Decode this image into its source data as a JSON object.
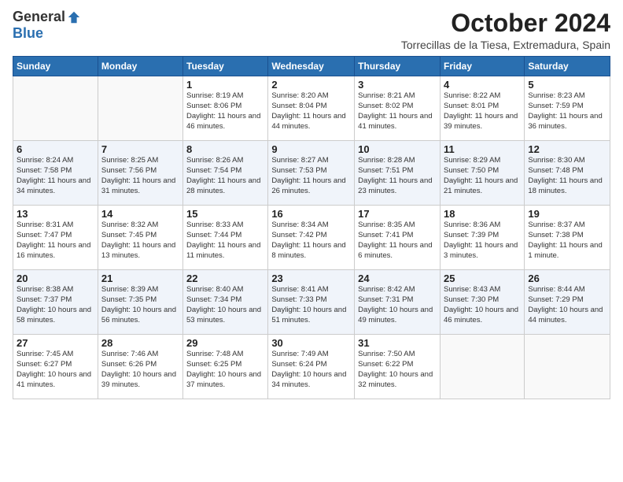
{
  "logo": {
    "general": "General",
    "blue": "Blue"
  },
  "header": {
    "month": "October 2024",
    "subtitle": "Torrecillas de la Tiesa, Extremadura, Spain"
  },
  "weekdays": [
    "Sunday",
    "Monday",
    "Tuesday",
    "Wednesday",
    "Thursday",
    "Friday",
    "Saturday"
  ],
  "weeks": [
    [
      {
        "day": "",
        "info": ""
      },
      {
        "day": "",
        "info": ""
      },
      {
        "day": "1",
        "info": "Sunrise: 8:19 AM\nSunset: 8:06 PM\nDaylight: 11 hours and 46 minutes."
      },
      {
        "day": "2",
        "info": "Sunrise: 8:20 AM\nSunset: 8:04 PM\nDaylight: 11 hours and 44 minutes."
      },
      {
        "day": "3",
        "info": "Sunrise: 8:21 AM\nSunset: 8:02 PM\nDaylight: 11 hours and 41 minutes."
      },
      {
        "day": "4",
        "info": "Sunrise: 8:22 AM\nSunset: 8:01 PM\nDaylight: 11 hours and 39 minutes."
      },
      {
        "day": "5",
        "info": "Sunrise: 8:23 AM\nSunset: 7:59 PM\nDaylight: 11 hours and 36 minutes."
      }
    ],
    [
      {
        "day": "6",
        "info": "Sunrise: 8:24 AM\nSunset: 7:58 PM\nDaylight: 11 hours and 34 minutes."
      },
      {
        "day": "7",
        "info": "Sunrise: 8:25 AM\nSunset: 7:56 PM\nDaylight: 11 hours and 31 minutes."
      },
      {
        "day": "8",
        "info": "Sunrise: 8:26 AM\nSunset: 7:54 PM\nDaylight: 11 hours and 28 minutes."
      },
      {
        "day": "9",
        "info": "Sunrise: 8:27 AM\nSunset: 7:53 PM\nDaylight: 11 hours and 26 minutes."
      },
      {
        "day": "10",
        "info": "Sunrise: 8:28 AM\nSunset: 7:51 PM\nDaylight: 11 hours and 23 minutes."
      },
      {
        "day": "11",
        "info": "Sunrise: 8:29 AM\nSunset: 7:50 PM\nDaylight: 11 hours and 21 minutes."
      },
      {
        "day": "12",
        "info": "Sunrise: 8:30 AM\nSunset: 7:48 PM\nDaylight: 11 hours and 18 minutes."
      }
    ],
    [
      {
        "day": "13",
        "info": "Sunrise: 8:31 AM\nSunset: 7:47 PM\nDaylight: 11 hours and 16 minutes."
      },
      {
        "day": "14",
        "info": "Sunrise: 8:32 AM\nSunset: 7:45 PM\nDaylight: 11 hours and 13 minutes."
      },
      {
        "day": "15",
        "info": "Sunrise: 8:33 AM\nSunset: 7:44 PM\nDaylight: 11 hours and 11 minutes."
      },
      {
        "day": "16",
        "info": "Sunrise: 8:34 AM\nSunset: 7:42 PM\nDaylight: 11 hours and 8 minutes."
      },
      {
        "day": "17",
        "info": "Sunrise: 8:35 AM\nSunset: 7:41 PM\nDaylight: 11 hours and 6 minutes."
      },
      {
        "day": "18",
        "info": "Sunrise: 8:36 AM\nSunset: 7:39 PM\nDaylight: 11 hours and 3 minutes."
      },
      {
        "day": "19",
        "info": "Sunrise: 8:37 AM\nSunset: 7:38 PM\nDaylight: 11 hours and 1 minute."
      }
    ],
    [
      {
        "day": "20",
        "info": "Sunrise: 8:38 AM\nSunset: 7:37 PM\nDaylight: 10 hours and 58 minutes."
      },
      {
        "day": "21",
        "info": "Sunrise: 8:39 AM\nSunset: 7:35 PM\nDaylight: 10 hours and 56 minutes."
      },
      {
        "day": "22",
        "info": "Sunrise: 8:40 AM\nSunset: 7:34 PM\nDaylight: 10 hours and 53 minutes."
      },
      {
        "day": "23",
        "info": "Sunrise: 8:41 AM\nSunset: 7:33 PM\nDaylight: 10 hours and 51 minutes."
      },
      {
        "day": "24",
        "info": "Sunrise: 8:42 AM\nSunset: 7:31 PM\nDaylight: 10 hours and 49 minutes."
      },
      {
        "day": "25",
        "info": "Sunrise: 8:43 AM\nSunset: 7:30 PM\nDaylight: 10 hours and 46 minutes."
      },
      {
        "day": "26",
        "info": "Sunrise: 8:44 AM\nSunset: 7:29 PM\nDaylight: 10 hours and 44 minutes."
      }
    ],
    [
      {
        "day": "27",
        "info": "Sunrise: 7:45 AM\nSunset: 6:27 PM\nDaylight: 10 hours and 41 minutes."
      },
      {
        "day": "28",
        "info": "Sunrise: 7:46 AM\nSunset: 6:26 PM\nDaylight: 10 hours and 39 minutes."
      },
      {
        "day": "29",
        "info": "Sunrise: 7:48 AM\nSunset: 6:25 PM\nDaylight: 10 hours and 37 minutes."
      },
      {
        "day": "30",
        "info": "Sunrise: 7:49 AM\nSunset: 6:24 PM\nDaylight: 10 hours and 34 minutes."
      },
      {
        "day": "31",
        "info": "Sunrise: 7:50 AM\nSunset: 6:22 PM\nDaylight: 10 hours and 32 minutes."
      },
      {
        "day": "",
        "info": ""
      },
      {
        "day": "",
        "info": ""
      }
    ]
  ]
}
